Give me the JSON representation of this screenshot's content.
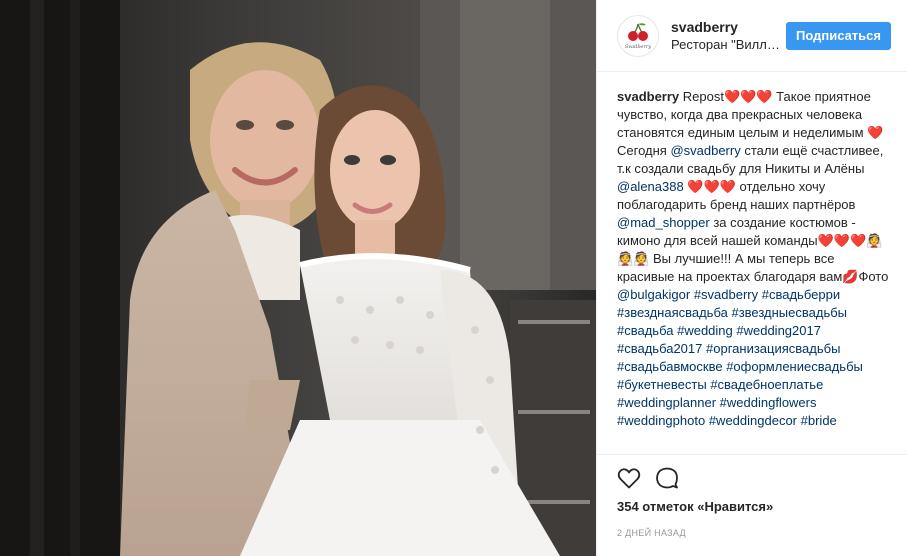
{
  "post": {
    "photo_alt": "",
    "username": "svadberry",
    "location": "Ресторан \"Вилла Рэй\"",
    "follow_label": "Подписаться",
    "avatar_script": "Svadberry",
    "caption": {
      "author": "svadberry",
      "p1": " Repost",
      "p2": " Такое приятное чувство, когда два прекрасных человека становятся единым целым и неделимым ",
      "p3": " Сегодня ",
      "mention1": "@svadberry",
      "p4": " стали ещё счастливее, т.к создали свадьбу для Никиты и Алёны ",
      "mention2": "@alena388",
      "p5": " отдельно хочу поблагодарить бренд наших партнёров ",
      "mention3": "@mad_shopper",
      "p6": " за создание костюмов - кимоно для всей нашей команды",
      "p7": " Вы лучшие!!! А мы теперь все красивые на проектах благодаря вам",
      "p8": "Фото ",
      "mention4": "@bulgakigor",
      "tags": [
        "#svadberry",
        "#свадьберри",
        "#звезднаясвадьба",
        "#звездныесвадьбы",
        "#свадьба",
        "#wedding",
        "#wedding2017",
        "#свадьба2017",
        "#организациясвадьбы",
        "#свадьбавмоскве",
        "#оформлениесвадьбы",
        "#букетневесты",
        "#свадебноеплатье",
        "#weddingplanner",
        "#weddingflowers",
        "#weddingphoto",
        "#weddingdecor",
        "#bride"
      ]
    },
    "likes": "354 отметок «Нравится»",
    "date": "2 ДНЕЙ НАЗАД",
    "icons": {
      "like": "heart-outline-icon",
      "comment": "comment-bubble-icon",
      "caption_heart": "red-heart-emoji",
      "bride_emoji": "bride-emoji",
      "lips_emoji": "lips-emoji"
    },
    "colors": {
      "follow": "#3897f0",
      "link": "#003569",
      "heart": "#e0142a"
    }
  }
}
